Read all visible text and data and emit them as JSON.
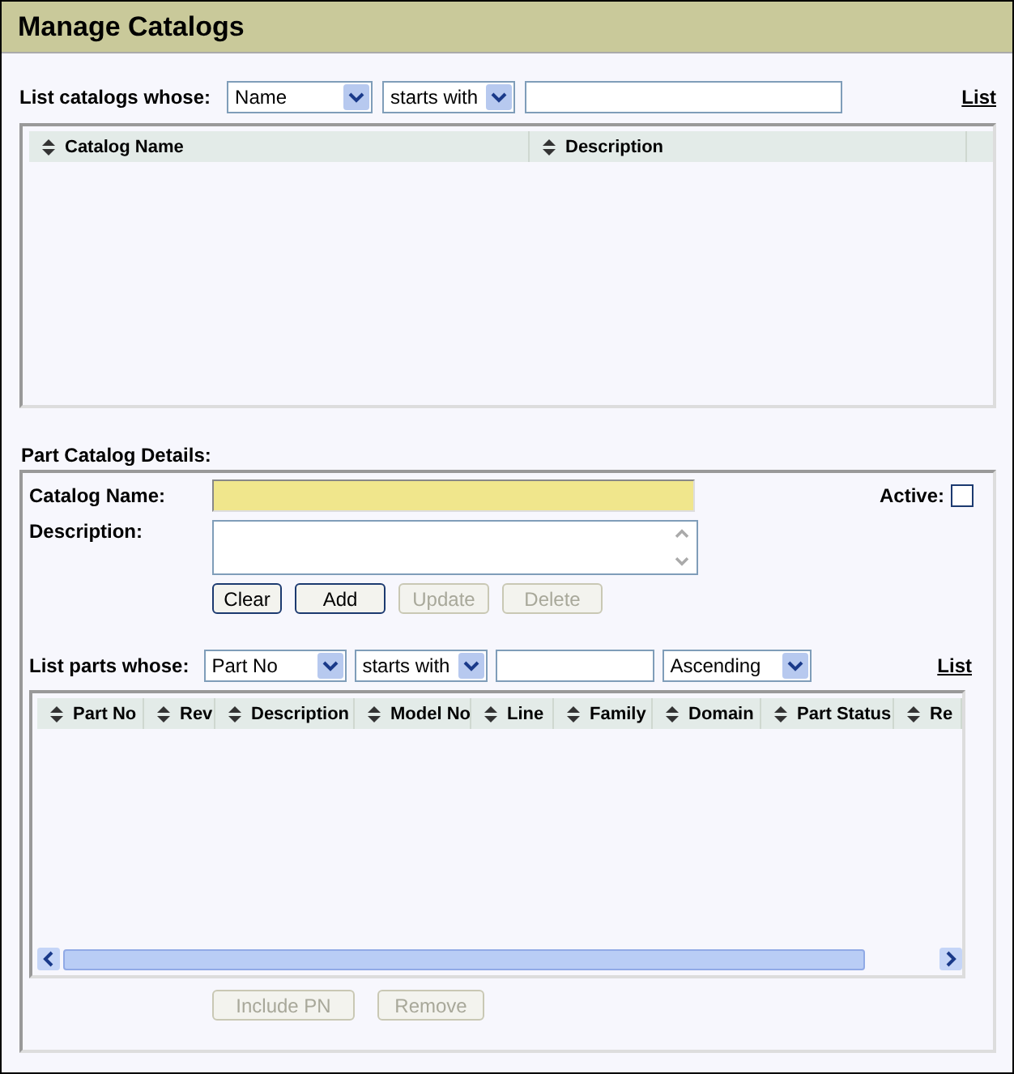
{
  "window": {
    "title": "Manage Catalogs"
  },
  "catalog_filter": {
    "label": "List catalogs whose:",
    "field": "Name",
    "operator": "starts with",
    "link": "List"
  },
  "catalog_table": {
    "columns": [
      "Catalog Name",
      "Description"
    ]
  },
  "details": {
    "title": "Part Catalog Details:",
    "name_label": "Catalog Name:",
    "description_label": "Description:",
    "active_label": "Active:",
    "active": false,
    "buttons": [
      {
        "label": "Clear",
        "disabled": false
      },
      {
        "label": "Add",
        "disabled": false
      },
      {
        "label": "Update",
        "disabled": true
      },
      {
        "label": "Delete",
        "disabled": true
      }
    ]
  },
  "parts_filter": {
    "label": "List parts whose:",
    "field": "Part No",
    "operator": "starts with",
    "order": "Ascending",
    "link": "List"
  },
  "parts_table": {
    "columns": [
      "Part No",
      "Rev",
      "Description",
      "Model No",
      "Line",
      "Family",
      "Domain",
      "Part Status",
      "Re"
    ]
  },
  "parts_buttons": [
    {
      "label": "Include PN",
      "disabled": true
    },
    {
      "label": "Remove",
      "disabled": true
    }
  ]
}
